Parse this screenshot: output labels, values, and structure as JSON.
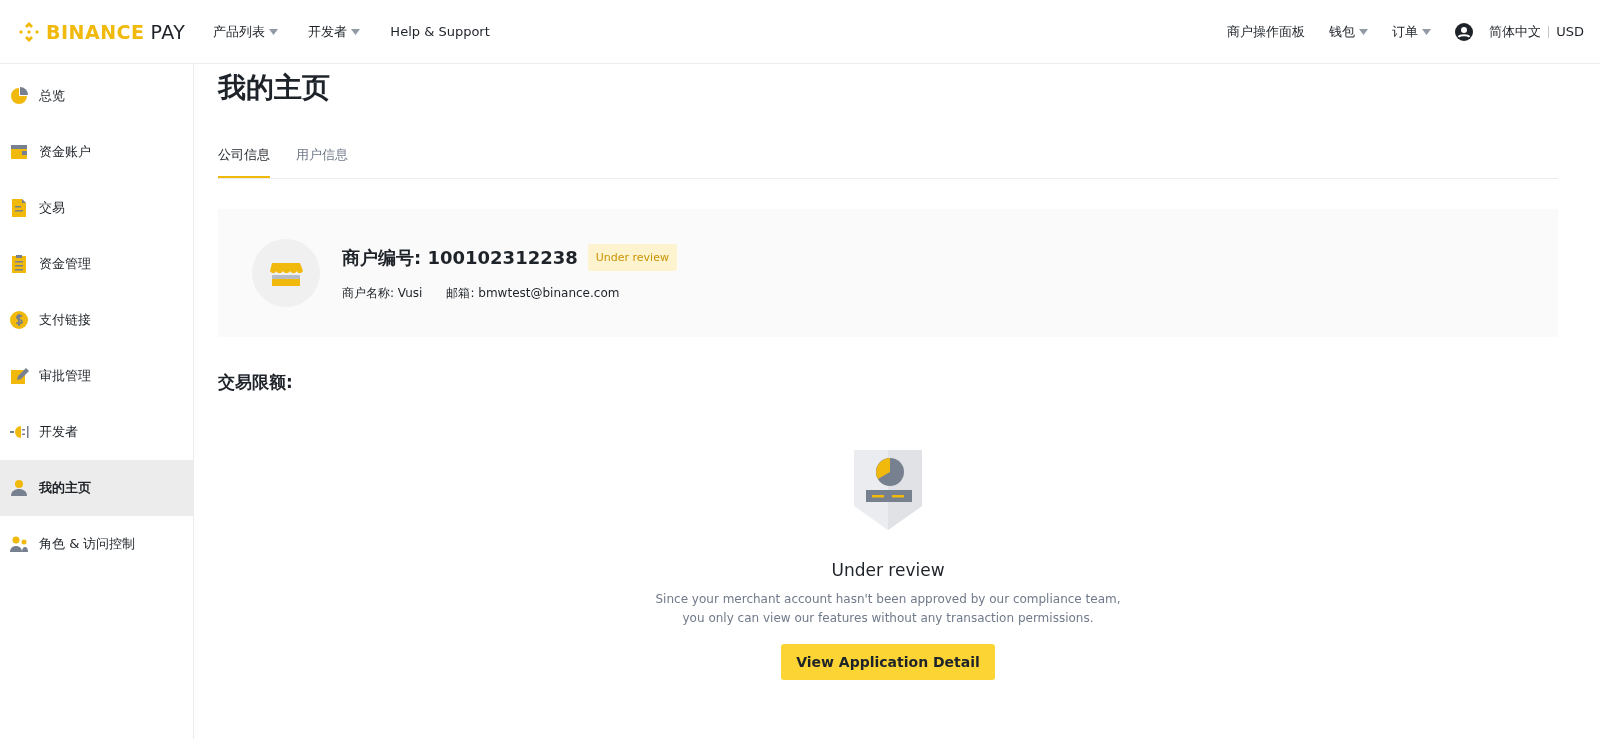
{
  "header": {
    "logo": {
      "brand": "BINANCE",
      "product": "PAY"
    },
    "nav": [
      {
        "label": "产品列表",
        "dropdown": true
      },
      {
        "label": "开发者",
        "dropdown": true
      },
      {
        "label": "Help & Support",
        "dropdown": false
      }
    ],
    "right_nav": [
      {
        "label": "商户操作面板",
        "dropdown": false
      },
      {
        "label": "钱包",
        "dropdown": true
      },
      {
        "label": "订单",
        "dropdown": true
      }
    ],
    "language": "简体中文",
    "currency": "USD"
  },
  "sidebar": {
    "items": [
      {
        "label": "总览",
        "selected": false
      },
      {
        "label": "资金账户",
        "selected": false
      },
      {
        "label": "交易",
        "selected": false
      },
      {
        "label": "资金管理",
        "selected": false
      },
      {
        "label": "支付链接",
        "selected": false
      },
      {
        "label": "审批管理",
        "selected": false
      },
      {
        "label": "开发者",
        "selected": false
      },
      {
        "label": "我的主页",
        "selected": true
      },
      {
        "label": "角色 & 访问控制",
        "selected": false
      }
    ]
  },
  "page": {
    "title": "我的主页",
    "tabs": [
      {
        "label": "公司信息",
        "selected": true
      },
      {
        "label": "用户信息",
        "selected": false
      }
    ],
    "merchant_card": {
      "id_label": "商户编号: 100102312238",
      "status_badge": "Under review",
      "name": "商户名称: Vusi",
      "email": "邮箱: bmwtest@binance.com"
    },
    "limits_heading": "交易限额:",
    "empty_state": {
      "title": "Under review",
      "description": "Since your merchant account hasn't been approved by our compliance team,\nyou only can view our features without any transaction permissions.",
      "button": "View Application Detail"
    }
  }
}
